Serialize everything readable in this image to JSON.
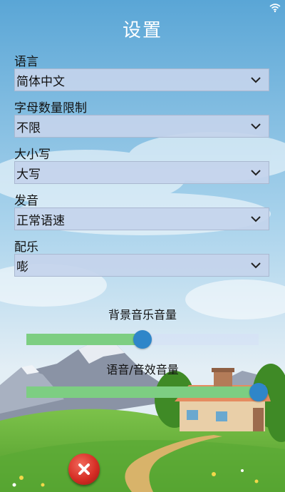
{
  "title": "设置",
  "settings": [
    {
      "label": "语言",
      "value": "简体中文"
    },
    {
      "label": "字母数量限制",
      "value": "不限"
    },
    {
      "label": "大小写",
      "value": "大写"
    },
    {
      "label": "发音",
      "value": "正常语速"
    },
    {
      "label": "配乐",
      "value": "嘭"
    }
  ],
  "sliders": {
    "music": {
      "label": "背景音乐音量",
      "level": 0.5
    },
    "effects": {
      "label": "语音/音效音量",
      "level": 1.0
    }
  },
  "icons": {
    "status": "wifi-icon",
    "dropdown": "chevron-down-icon",
    "close": "close-icon"
  },
  "colors": {
    "slider_fill": "#7dce82",
    "slider_thumb": "#2f86c9",
    "close_button": "#d62e25"
  }
}
